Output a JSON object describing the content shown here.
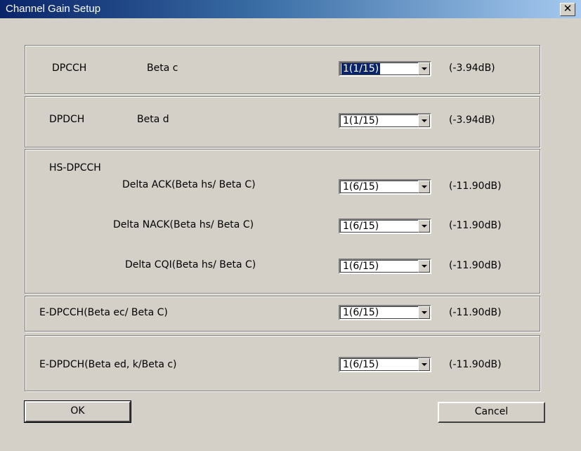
{
  "window": {
    "title": "Channel Gain Setup",
    "close_glyph": "✕"
  },
  "dpcch": {
    "name": "DPCCH",
    "param": "Beta c",
    "value": "1(1/15)",
    "db": "(-3.94dB)"
  },
  "dpdch": {
    "name": "DPDCH",
    "param": "Beta d",
    "value": "1(1/15)",
    "db": "(-3.94dB)"
  },
  "hsdpcch": {
    "name": "HS-DPCCH",
    "rows": [
      {
        "label": "Delta ACK(Beta hs/ Beta C)",
        "value": "1(6/15)",
        "db": "(-11.90dB)"
      },
      {
        "label": "Delta NACK(Beta hs/ Beta C)",
        "value": "1(6/15)",
        "db": "(-11.90dB)"
      },
      {
        "label": "Delta CQI(Beta hs/ Beta C)",
        "value": "1(6/15)",
        "db": "(-11.90dB)"
      }
    ]
  },
  "edpcch": {
    "label": "E-DPCCH(Beta ec/ Beta C)",
    "value": "1(6/15)",
    "db": "(-11.90dB)"
  },
  "edpdch": {
    "label": "E-DPDCH(Beta ed, k/Beta c)",
    "value": "1(6/15)",
    "db": "(-11.90dB)"
  },
  "buttons": {
    "ok": "OK",
    "cancel": "Cancel"
  }
}
